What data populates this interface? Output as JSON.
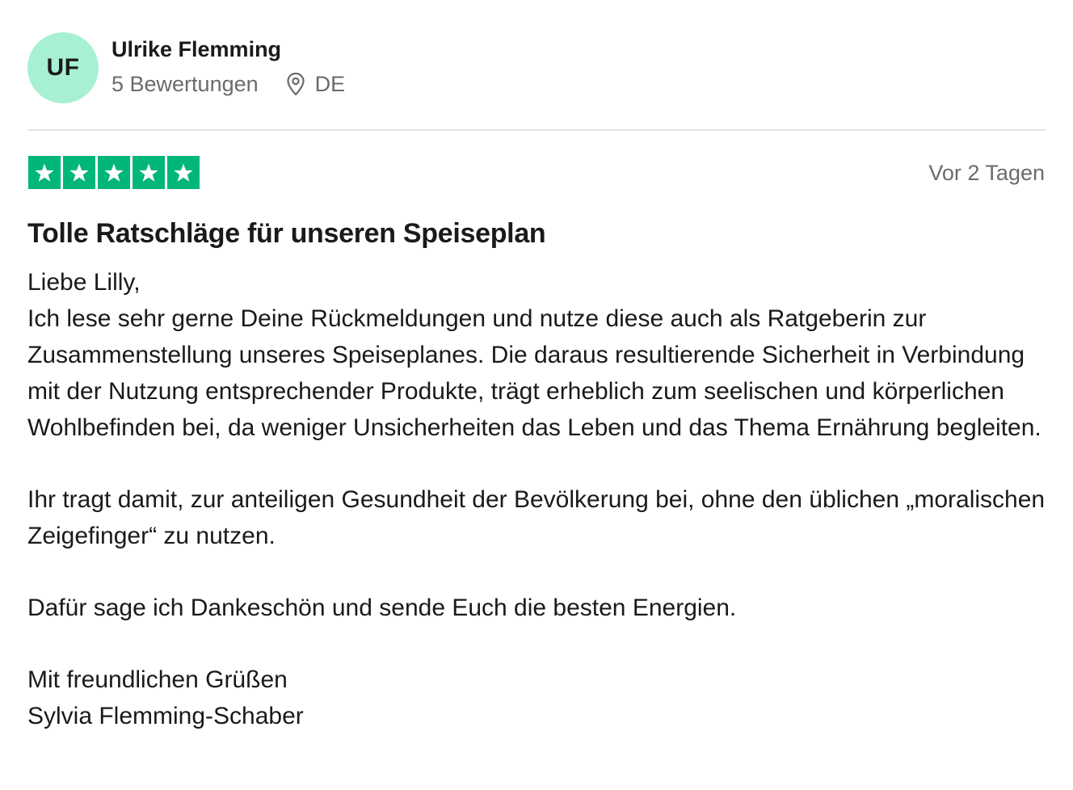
{
  "reviewer": {
    "initials": "UF",
    "name": "Ulrike Flemming",
    "reviews_count": "5 Bewertungen",
    "location_icon": "location-pin-icon",
    "country": "DE",
    "avatar_color": "#a8f0d4"
  },
  "review": {
    "rating": 5,
    "max_rating": 5,
    "star_color": "#00b67a",
    "date": "Vor 2 Tagen",
    "title": "Tolle Ratschläge für unseren Speiseplan",
    "paragraphs": [
      "Liebe Lilly,",
      "Ich lese sehr gerne Deine Rückmeldungen und nutze diese auch als Ratgeberin zur Zusammenstellung unseres Speiseplanes. Die daraus resultierende Sicherheit in Verbindung mit der Nutzung entsprechender Produkte, trägt erheblich zum seelischen und körperlichen Wohlbefinden bei, da weniger Unsicherheiten das Leben und das Thema Ernährung begleiten.",
      "Ihr tragt damit, zur anteiligen Gesundheit der Bevölkerung bei, ohne den üblichen „moralischen Zeigefinger“ zu nutzen.",
      "Dafür sage ich Dankeschön und sende Euch die besten Energien.",
      "Mit freundlichen Grüßen",
      "Sylvia Flemming-Schaber"
    ]
  }
}
